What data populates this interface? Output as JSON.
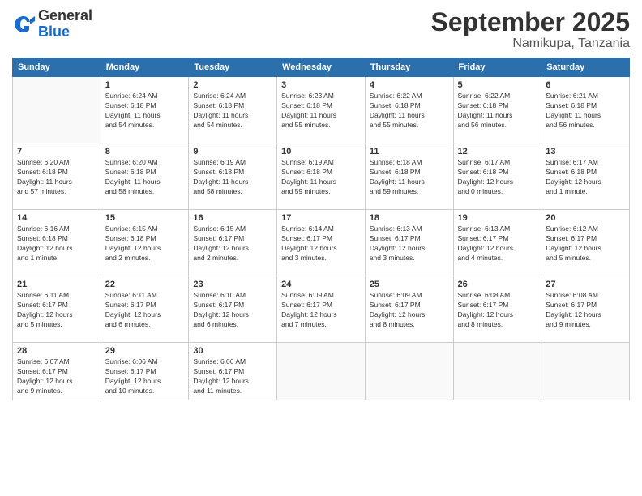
{
  "logo": {
    "general": "General",
    "blue": "Blue"
  },
  "title": "September 2025",
  "location": "Namikupa, Tanzania",
  "days_of_week": [
    "Sunday",
    "Monday",
    "Tuesday",
    "Wednesday",
    "Thursday",
    "Friday",
    "Saturday"
  ],
  "weeks": [
    [
      {
        "day": "",
        "info": ""
      },
      {
        "day": "1",
        "info": "Sunrise: 6:24 AM\nSunset: 6:18 PM\nDaylight: 11 hours\nand 54 minutes."
      },
      {
        "day": "2",
        "info": "Sunrise: 6:24 AM\nSunset: 6:18 PM\nDaylight: 11 hours\nand 54 minutes."
      },
      {
        "day": "3",
        "info": "Sunrise: 6:23 AM\nSunset: 6:18 PM\nDaylight: 11 hours\nand 55 minutes."
      },
      {
        "day": "4",
        "info": "Sunrise: 6:22 AM\nSunset: 6:18 PM\nDaylight: 11 hours\nand 55 minutes."
      },
      {
        "day": "5",
        "info": "Sunrise: 6:22 AM\nSunset: 6:18 PM\nDaylight: 11 hours\nand 56 minutes."
      },
      {
        "day": "6",
        "info": "Sunrise: 6:21 AM\nSunset: 6:18 PM\nDaylight: 11 hours\nand 56 minutes."
      }
    ],
    [
      {
        "day": "7",
        "info": "Sunrise: 6:20 AM\nSunset: 6:18 PM\nDaylight: 11 hours\nand 57 minutes."
      },
      {
        "day": "8",
        "info": "Sunrise: 6:20 AM\nSunset: 6:18 PM\nDaylight: 11 hours\nand 58 minutes."
      },
      {
        "day": "9",
        "info": "Sunrise: 6:19 AM\nSunset: 6:18 PM\nDaylight: 11 hours\nand 58 minutes."
      },
      {
        "day": "10",
        "info": "Sunrise: 6:19 AM\nSunset: 6:18 PM\nDaylight: 11 hours\nand 59 minutes."
      },
      {
        "day": "11",
        "info": "Sunrise: 6:18 AM\nSunset: 6:18 PM\nDaylight: 11 hours\nand 59 minutes."
      },
      {
        "day": "12",
        "info": "Sunrise: 6:17 AM\nSunset: 6:18 PM\nDaylight: 12 hours\nand 0 minutes."
      },
      {
        "day": "13",
        "info": "Sunrise: 6:17 AM\nSunset: 6:18 PM\nDaylight: 12 hours\nand 1 minute."
      }
    ],
    [
      {
        "day": "14",
        "info": "Sunrise: 6:16 AM\nSunset: 6:18 PM\nDaylight: 12 hours\nand 1 minute."
      },
      {
        "day": "15",
        "info": "Sunrise: 6:15 AM\nSunset: 6:18 PM\nDaylight: 12 hours\nand 2 minutes."
      },
      {
        "day": "16",
        "info": "Sunrise: 6:15 AM\nSunset: 6:17 PM\nDaylight: 12 hours\nand 2 minutes."
      },
      {
        "day": "17",
        "info": "Sunrise: 6:14 AM\nSunset: 6:17 PM\nDaylight: 12 hours\nand 3 minutes."
      },
      {
        "day": "18",
        "info": "Sunrise: 6:13 AM\nSunset: 6:17 PM\nDaylight: 12 hours\nand 3 minutes."
      },
      {
        "day": "19",
        "info": "Sunrise: 6:13 AM\nSunset: 6:17 PM\nDaylight: 12 hours\nand 4 minutes."
      },
      {
        "day": "20",
        "info": "Sunrise: 6:12 AM\nSunset: 6:17 PM\nDaylight: 12 hours\nand 5 minutes."
      }
    ],
    [
      {
        "day": "21",
        "info": "Sunrise: 6:11 AM\nSunset: 6:17 PM\nDaylight: 12 hours\nand 5 minutes."
      },
      {
        "day": "22",
        "info": "Sunrise: 6:11 AM\nSunset: 6:17 PM\nDaylight: 12 hours\nand 6 minutes."
      },
      {
        "day": "23",
        "info": "Sunrise: 6:10 AM\nSunset: 6:17 PM\nDaylight: 12 hours\nand 6 minutes."
      },
      {
        "day": "24",
        "info": "Sunrise: 6:09 AM\nSunset: 6:17 PM\nDaylight: 12 hours\nand 7 minutes."
      },
      {
        "day": "25",
        "info": "Sunrise: 6:09 AM\nSunset: 6:17 PM\nDaylight: 12 hours\nand 8 minutes."
      },
      {
        "day": "26",
        "info": "Sunrise: 6:08 AM\nSunset: 6:17 PM\nDaylight: 12 hours\nand 8 minutes."
      },
      {
        "day": "27",
        "info": "Sunrise: 6:08 AM\nSunset: 6:17 PM\nDaylight: 12 hours\nand 9 minutes."
      }
    ],
    [
      {
        "day": "28",
        "info": "Sunrise: 6:07 AM\nSunset: 6:17 PM\nDaylight: 12 hours\nand 9 minutes."
      },
      {
        "day": "29",
        "info": "Sunrise: 6:06 AM\nSunset: 6:17 PM\nDaylight: 12 hours\nand 10 minutes."
      },
      {
        "day": "30",
        "info": "Sunrise: 6:06 AM\nSunset: 6:17 PM\nDaylight: 12 hours\nand 11 minutes."
      },
      {
        "day": "",
        "info": ""
      },
      {
        "day": "",
        "info": ""
      },
      {
        "day": "",
        "info": ""
      },
      {
        "day": "",
        "info": ""
      }
    ]
  ]
}
